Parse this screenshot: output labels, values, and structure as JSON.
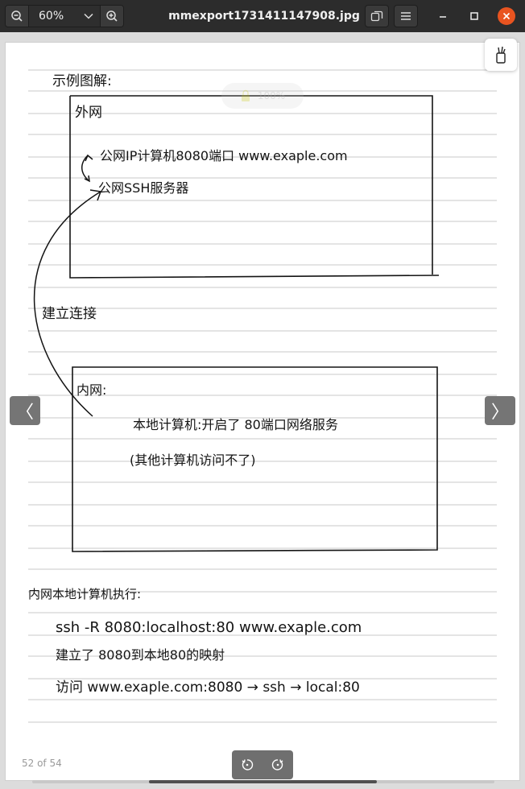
{
  "window": {
    "title": "mmexport1731411147908.jpg"
  },
  "header": {
    "zoom_value": "60%",
    "icons": {
      "zoom_out": "zoom-out-icon",
      "zoom_in": "zoom-in-icon",
      "dropdown": "chevron-down-icon",
      "gallery": "gallery-icon",
      "menu": "hamburger-menu-icon",
      "minimize": "minimize-icon",
      "maximize": "maximize-icon",
      "close": "close-icon"
    }
  },
  "viewer": {
    "page_counter": "52 of 54",
    "zoom_overlay": "100%",
    "nav_prev": "〈",
    "nav_next": "〉",
    "scroll_fraction": 0.49
  },
  "note": {
    "heading": "示例图解:",
    "outer_box_label": "外网",
    "outer_line1": "公网IP计算机8080端口 www.exaple.com",
    "outer_line2": "公网SSH服务器",
    "connect_label": "建立连接",
    "inner_box_label": "内网:",
    "inner_line1": "本地计算机:开启了 80端口网络服务",
    "inner_line2": "(其他计算机访问不了)",
    "section2_heading": "内网本地计算机执行:",
    "cmd_line": "ssh -R 8080:localhost:80 www.exaple.com",
    "explain_line": "建立了 8080到本地80的映射",
    "access_line": "访问 www.exaple.com:8080 → ssh → local:80"
  },
  "colors": {
    "header_bg": "#2c2c2c",
    "close_button": "#e95420",
    "paper": "#ffffff",
    "ruled_line": "#c9c9c9",
    "ink": "#141414",
    "nav_button": "#757575"
  }
}
